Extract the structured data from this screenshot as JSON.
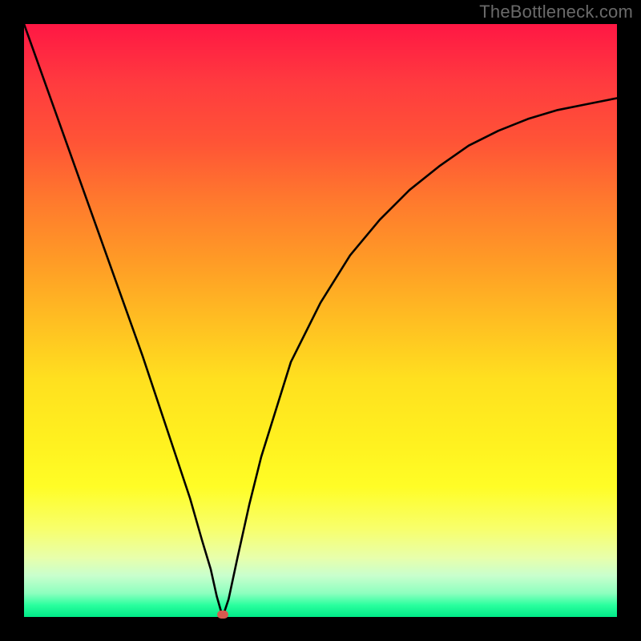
{
  "watermark": "TheBottleneck.com",
  "chart_data": {
    "type": "line",
    "title": "",
    "xlabel": "",
    "ylabel": "",
    "xlim": [
      0,
      100
    ],
    "ylim": [
      0,
      100
    ],
    "grid": false,
    "marker": {
      "x": 33.5,
      "y": 0
    },
    "series": [
      {
        "name": "curve",
        "x": [
          0,
          5,
          10,
          15,
          20,
          25,
          28,
          30,
          31.5,
          32.5,
          33.5,
          34.5,
          36,
          38,
          40,
          45,
          50,
          55,
          60,
          65,
          70,
          75,
          80,
          85,
          90,
          95,
          100
        ],
        "y": [
          100,
          86,
          72,
          58,
          44,
          29,
          20,
          13,
          8,
          3.5,
          0,
          3,
          10,
          19,
          27,
          43,
          53,
          61,
          67,
          72,
          76,
          79.5,
          82,
          84,
          85.5,
          86.5,
          87.5
        ]
      }
    ],
    "background_gradient": {
      "top": "#ff1744",
      "bottom": "#00e987"
    }
  }
}
